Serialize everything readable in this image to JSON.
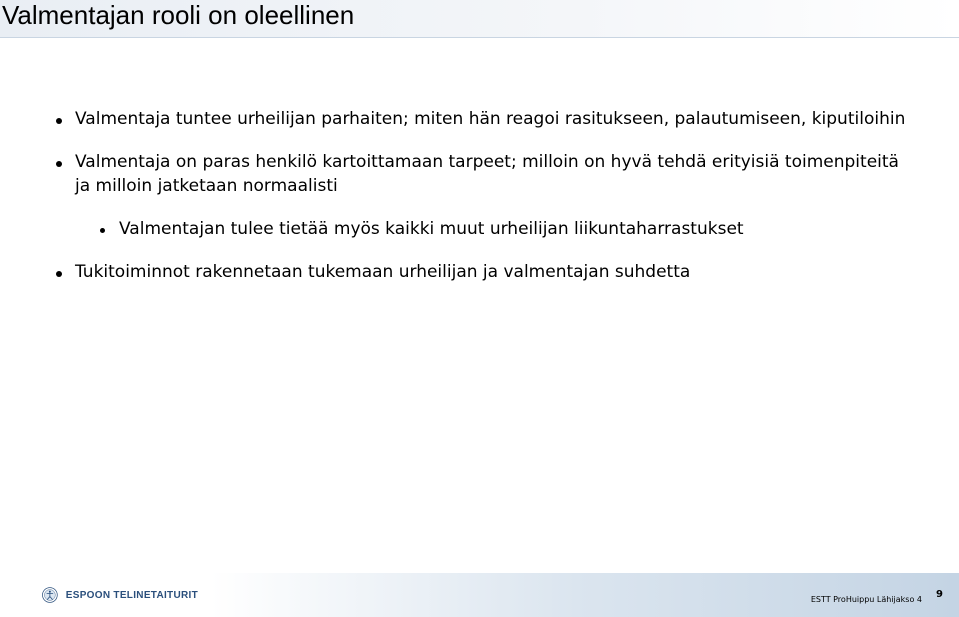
{
  "slide": {
    "title": "Valmentajan rooli on oleellinen",
    "bullets": [
      "Valmentaja tuntee urheilijan parhaiten; miten hän reagoi rasitukseen, palautumiseen, kiputiloihin",
      "Valmentaja on paras henkilö kartoittamaan tarpeet; milloin on hyvä tehdä erityisiä toimenpiteitä ja milloin jatketaan normaalisti",
      "Valmentajan tulee tietää myös kaikki muut urheilijan liikuntaharrastukset",
      "Tukitoiminnot rakennetaan tukemaan urheilijan ja valmentajan suhdetta"
    ]
  },
  "footer": {
    "logo_text": "ESPOON TELINETAITURIT",
    "caption": "ESTT ProHuippu Lähijakso 4",
    "page_number": "9"
  },
  "colors": {
    "title_bar": "#e9eef4",
    "footer_gradient_end": "#c4d4e4",
    "logo_text": "#2a4f7c"
  },
  "icons": {
    "logo": "club-emblem-icon"
  }
}
